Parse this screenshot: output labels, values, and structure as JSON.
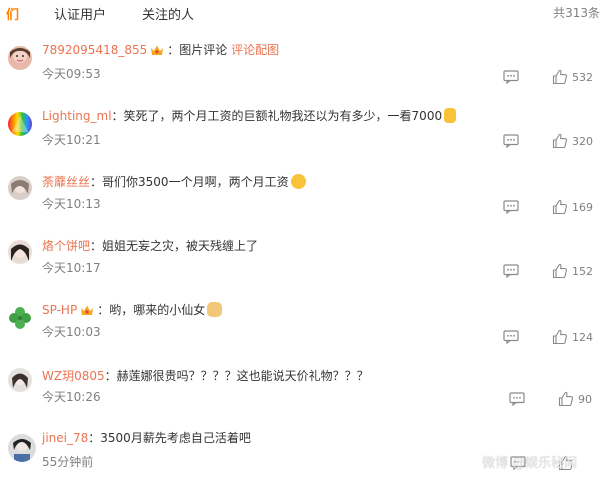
{
  "tabs": {
    "active": "们",
    "verified": "认证用户",
    "following": "关注的人"
  },
  "total": "共313条",
  "comments": [
    {
      "user": "7892095418_855",
      "sep": "：",
      "text": "图片评论",
      "link": "评论配图",
      "time": "今天09:53",
      "likes": "532"
    },
    {
      "user": "Lighting_ml",
      "sep": "：",
      "text": "笑死了，两个月工资的巨额礼物我还以为有多少，一看7000",
      "time": "今天10:21",
      "likes": "320"
    },
    {
      "user": "荼蘼丝丝",
      "sep": "：",
      "text": "哥们你3500一个月啊，两个月工资",
      "time": "今天10:13",
      "likes": "169"
    },
    {
      "user": "烙个饼吧",
      "sep": "：",
      "text": "姐姐无妄之灾，被天残缠上了",
      "time": "今天10:17",
      "likes": "152"
    },
    {
      "user": "SP-HP",
      "sep": "：",
      "text": "哟，哪来的小仙女",
      "time": "今天10:03",
      "likes": "124"
    },
    {
      "user": "WZ玥0805",
      "sep": "：",
      "text": "赫莲娜很贵吗？？？？这也能说天价礼物？？？",
      "time": "今天10:26",
      "likes": "90"
    },
    {
      "user": "jinei_78",
      "sep": "：",
      "text": "3500月薪先考虑自己活着吧",
      "time": "55分钟前",
      "likes": ""
    }
  ],
  "watermark": "微博 @娱乐秘闻",
  "icons": {
    "reply": "comment-bubble-icon",
    "like": "thumbs-up-icon",
    "vip": "crown-badge-icon"
  },
  "colors": {
    "username": "#eb7350",
    "accent": "#ff8200",
    "meta": "#808080",
    "text": "#333333"
  }
}
